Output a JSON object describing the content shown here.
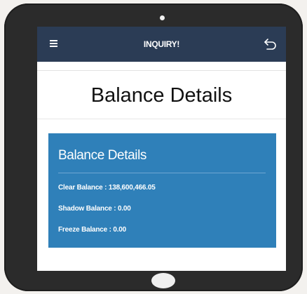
{
  "header": {
    "title": "INQUIRY!"
  },
  "page": {
    "title": "Balance Details"
  },
  "card": {
    "title": "Balance Details",
    "rows": [
      {
        "label": "Clear Balance",
        "value": "138,600,466.05"
      },
      {
        "label": "Shadow Balance",
        "value": "0.00"
      },
      {
        "label": "Freeze Balance",
        "value": "0.00"
      }
    ]
  },
  "icons": {
    "menu": "hamburger-menu-icon",
    "back": "back-arrow-icon"
  },
  "colors": {
    "topbar": "#2b3c55",
    "card": "#2f80b9",
    "device": "#2b2b2b"
  }
}
